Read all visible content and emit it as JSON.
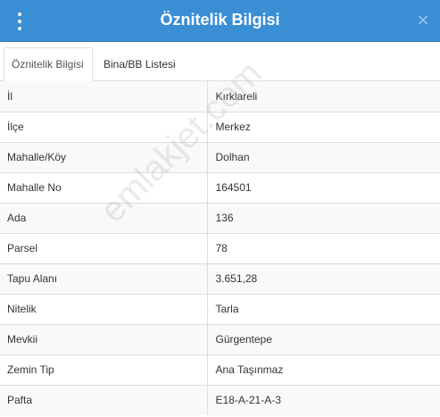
{
  "header": {
    "title": "Öznitelik Bilgisi",
    "close_glyph": "✕"
  },
  "tabs": [
    {
      "label": "Öznitelik Bilgisi",
      "active": true
    },
    {
      "label": "Bina/BB Listesi",
      "active": false
    }
  ],
  "rows": [
    {
      "key": "İl",
      "value": "Kırklareli"
    },
    {
      "key": "İlçe",
      "value": "Merkez"
    },
    {
      "key": "Mahalle/Köy",
      "value": "Dolhan"
    },
    {
      "key": "Mahalle No",
      "value": "164501"
    },
    {
      "key": "Ada",
      "value": "136"
    },
    {
      "key": "Parsel",
      "value": "78"
    },
    {
      "key": "Tapu Alanı",
      "value": "3.651,28"
    },
    {
      "key": "Nitelik",
      "value": "Tarla"
    },
    {
      "key": "Mevkii",
      "value": "Gürgentepe"
    },
    {
      "key": "Zemin Tip",
      "value": "Ana Taşınmaz"
    },
    {
      "key": "Pafta",
      "value": "E18-A-21-A-3"
    }
  ],
  "watermark": "emlakjet.com",
  "colors": {
    "header_bg": "#3a8ed4",
    "row_alt": "#f9f9f9",
    "border": "#dddddd"
  }
}
